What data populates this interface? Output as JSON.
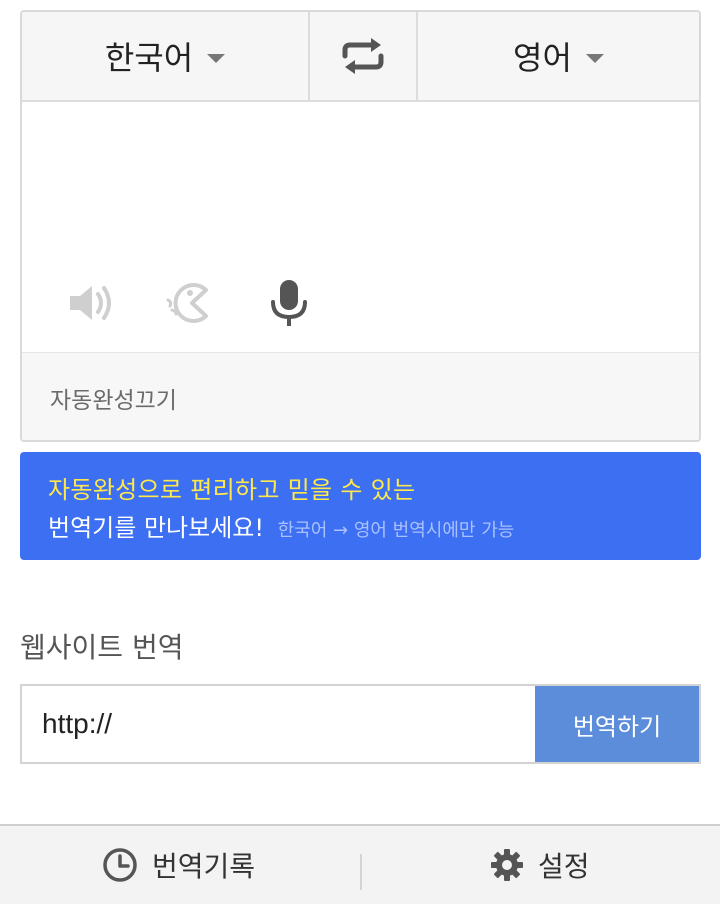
{
  "lang_bar": {
    "source_lang": "한국어",
    "target_lang": "영어",
    "swap_icon": "swap-arrows-icon"
  },
  "input_tools": {
    "speaker_icon": "speaker-icon",
    "handwriting_icon": "handwriting-icon",
    "mic_icon": "microphone-icon"
  },
  "footer": {
    "autocomplete_toggle": "자동완성끄기"
  },
  "promo": {
    "line1": "자동완성으로 편리하고 믿을 수 있는",
    "line2": "번역기를 만나보세요!",
    "note": "한국어 → 영어 번역시에만 가능"
  },
  "website_translate": {
    "title": "웹사이트 번역",
    "url_value": "http://",
    "button_label": "번역하기"
  },
  "bottom_bar": {
    "history_label": "번역기록",
    "settings_label": "설정",
    "history_icon": "clock-icon",
    "settings_icon": "gear-icon"
  },
  "colors": {
    "promo_bg": "#3d6ff2",
    "promo_highlight": "#ffe94a",
    "translate_button": "#5b8ddb"
  }
}
